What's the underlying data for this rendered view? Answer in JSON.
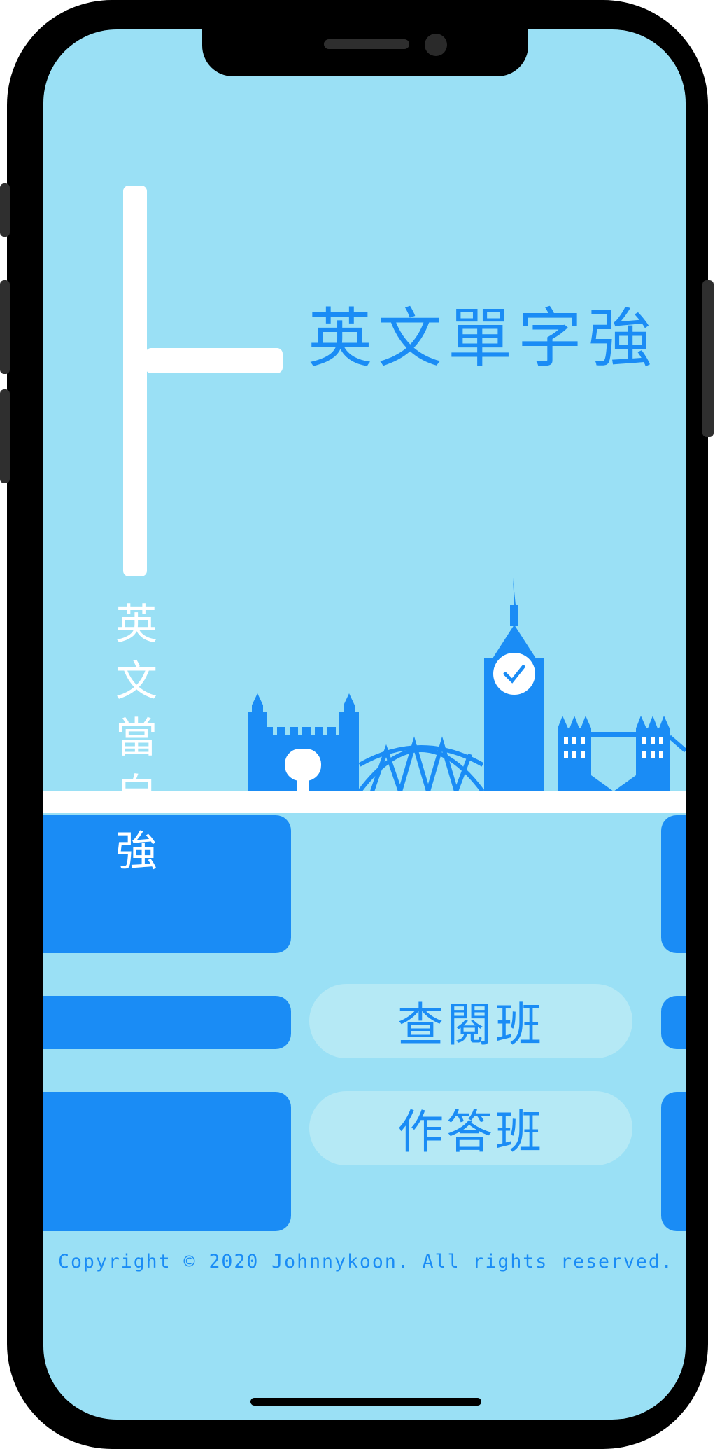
{
  "app": {
    "title": "英文單字強",
    "slogan": [
      "英",
      "文",
      "當",
      "自",
      "強"
    ]
  },
  "menu": {
    "browse_label": "查閱班",
    "answer_label": "作答班"
  },
  "footer": {
    "copyright": "Copyright © 2020 Johnnykoon. All rights reserved."
  },
  "colors": {
    "background": "#9ae0f5",
    "accent": "#1a8cf5",
    "pill": "#b5e9f5"
  },
  "icons": [
    "london-skyline-icon",
    "clock-icon"
  ]
}
